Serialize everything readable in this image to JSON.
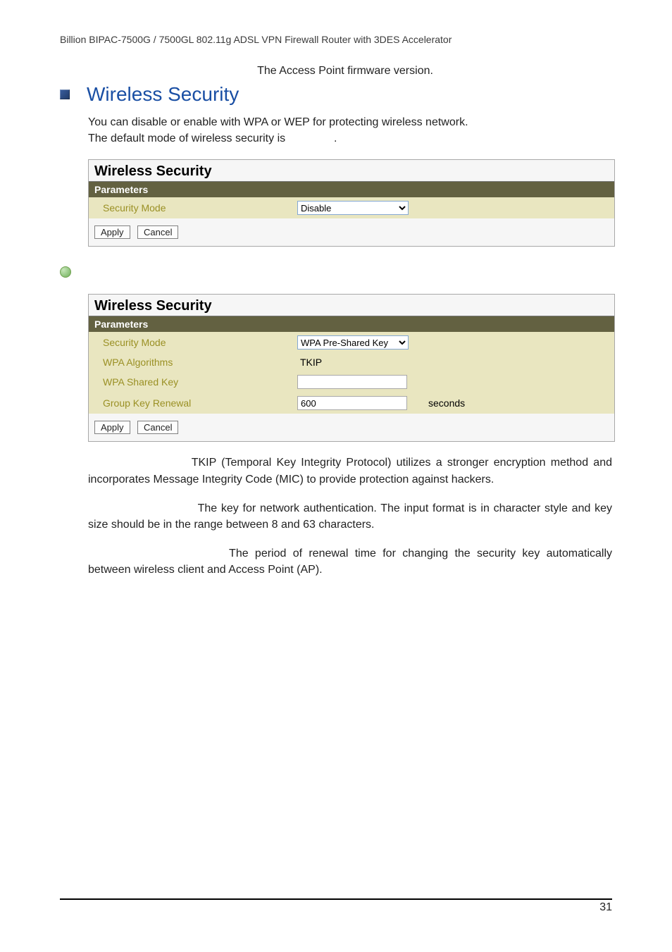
{
  "header": "Billion BIPAC-7500G / 7500GL 802.11g ADSL VPN Firewall Router with 3DES Accelerator",
  "firmware_line": "The Access Point firmware version.",
  "section_title": "Wireless Security",
  "intro_line1": "You can disable or enable with WPA or WEP for protecting wireless network.",
  "intro_line2": "The default mode of wireless security is",
  "intro_trailing": ".",
  "panel1": {
    "title": "Wireless Security",
    "subtitle": "Parameters",
    "rows": [
      {
        "label": "Security Mode",
        "type": "select",
        "value": "Disable",
        "options": [
          "Disable"
        ]
      }
    ],
    "apply": "Apply",
    "cancel": "Cancel"
  },
  "panel2": {
    "title": "Wireless Security",
    "subtitle": "Parameters",
    "rows": {
      "security_mode": {
        "label": "Security Mode",
        "value": "WPA Pre-Shared Key",
        "options": [
          "WPA Pre-Shared Key"
        ]
      },
      "wpa_alg": {
        "label": "WPA Algorithms",
        "value": "TKIP"
      },
      "wpa_key": {
        "label": "WPA Shared Key",
        "value": ""
      },
      "group_renewal": {
        "label": "Group Key Renewal",
        "value": "600",
        "suffix": "seconds"
      }
    },
    "apply": "Apply",
    "cancel": "Cancel"
  },
  "desc": {
    "tkip": "TKIP (Temporal Key Integrity Protocol) utilizes a stronger encryption method and incorporates Message Integrity Code (MIC) to provide protection against hackers.",
    "key_a": "The key for network authentication",
    "key_b": ". The input format is in character style and key size should be in the range between 8 and 63 characters.",
    "renewal": "The period of renewal time for changing the security key automatically between wireless client and Access Point (AP)."
  },
  "pad": {
    "tkip": "                                 ",
    "key": "                                   ",
    "renewal": "                                             "
  },
  "page_number": "31"
}
